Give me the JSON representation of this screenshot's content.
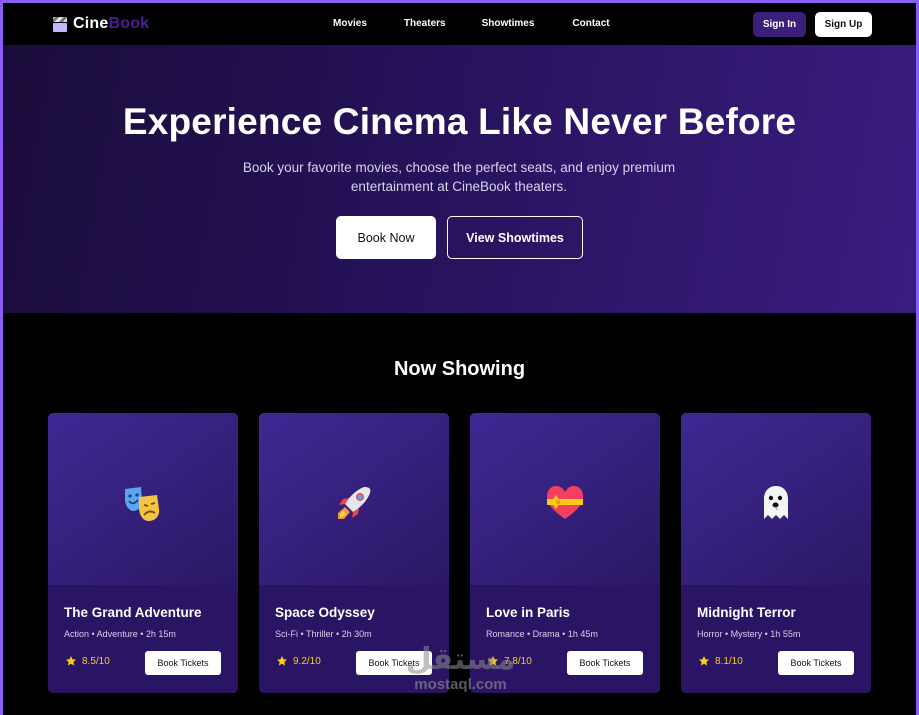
{
  "nav": {
    "logo_part1": "Cine",
    "logo_part2": "Book",
    "links": [
      "Movies",
      "Theaters",
      "Showtimes",
      "Contact"
    ],
    "sign_in": "Sign In",
    "sign_up": "Sign Up"
  },
  "hero": {
    "title": "Experience Cinema Like Never Before",
    "subtitle": "Book your favorite movies, choose the perfect seats, and enjoy premium entertainment at CineBook theaters.",
    "primary_button": "Book Now",
    "secondary_button": "View Showtimes"
  },
  "section": {
    "title": "Now Showing"
  },
  "movies": [
    {
      "title": "The Grand Adventure",
      "meta": "Action • Adventure • 2h 15m",
      "rating": "8.5/10",
      "button": "Book Tickets",
      "icon": "theater-masks-icon"
    },
    {
      "title": "Space Odyssey",
      "meta": "Sci-Fi • Thriller • 2h 30m",
      "rating": "9.2/10",
      "button": "Book Tickets",
      "icon": "rocket-icon"
    },
    {
      "title": "Love in Paris",
      "meta": "Romance • Drama • 1h 45m",
      "rating": "7.8/10",
      "button": "Book Tickets",
      "icon": "gift-heart-icon"
    },
    {
      "title": "Midnight Terror",
      "meta": "Horror • Mystery • 1h 55m",
      "rating": "8.1/10",
      "button": "Book Tickets",
      "icon": "ghost-icon"
    }
  ],
  "watermark": {
    "arabic": "مستقل",
    "latin": "mostaql.com"
  },
  "colors": {
    "accent": "#8b5cf6",
    "sign_in_bg": "#3b1f7a",
    "card_bg": "#2a1565",
    "rating": "#facc15"
  }
}
